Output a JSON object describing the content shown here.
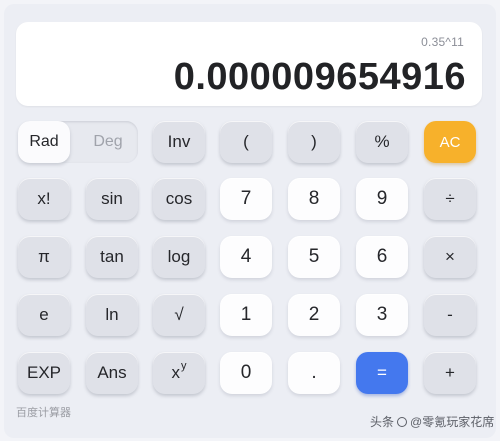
{
  "display": {
    "expression": "0.35^11",
    "result": "0.000009654916"
  },
  "mode": {
    "rad_label": "Rad",
    "deg_label": "Deg",
    "active": "Rad"
  },
  "keys": {
    "inv": "Inv",
    "lparen": "(",
    "rparen": ")",
    "percent": "%",
    "ac": "AC",
    "factorial": "x!",
    "sin": "sin",
    "cos": "cos",
    "seven": "7",
    "eight": "8",
    "nine": "9",
    "divide": "÷",
    "pi": "π",
    "tan": "tan",
    "log": "log",
    "four": "4",
    "five": "5",
    "six": "6",
    "multiply": "×",
    "e": "e",
    "ln": "ln",
    "sqrt": "√",
    "one": "1",
    "two": "2",
    "three": "3",
    "minus": "-",
    "exp": "EXP",
    "ans": "Ans",
    "power_base": "x",
    "power_exp": "y",
    "zero": "0",
    "dot": ".",
    "equals": "=",
    "plus": "+"
  },
  "caption": "百度计算器",
  "watermark": {
    "prefix": "头条",
    "handle": "@零氪玩家花席"
  },
  "colors": {
    "ac": "#f7b12b",
    "equals": "#4478ee",
    "function_key": "#dfe1e8",
    "number_key": "#fdfdfe",
    "background": "#eceef4"
  }
}
